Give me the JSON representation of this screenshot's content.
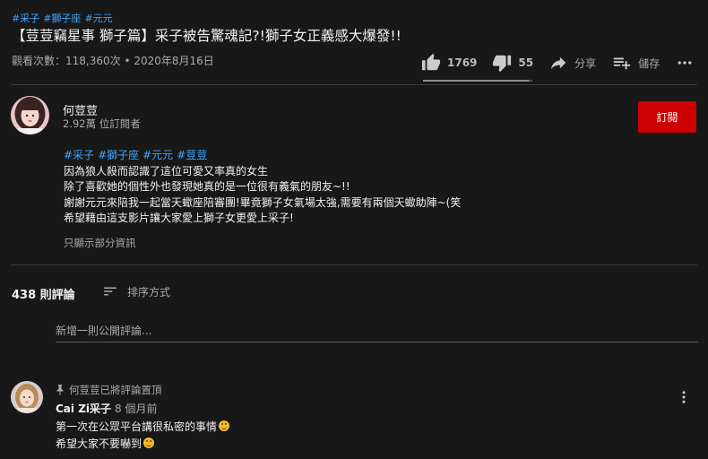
{
  "video": {
    "hashtags": [
      "#采子",
      "#獅子座",
      "#元元"
    ],
    "title": "【荳荳竊星事 獅子篇】采子被告驚魂記?!獅子女正義感大爆發!!",
    "views": "觀看次數：118,360次",
    "date": "2020年8月16日",
    "likes": "1769",
    "dislikes": "55",
    "share_label": "分享",
    "save_label": "儲存",
    "like_ratio": 0.97
  },
  "channel": {
    "name": "何荳荳",
    "subscribers": "2.92萬 位訂閱者",
    "subscribe_label": "訂閱"
  },
  "description": {
    "hashtags": [
      "#采子",
      "#獅子座",
      "#元元",
      "#荳荳"
    ],
    "lines": [
      "因為狼人殺而認識了這位可愛又率真的女生",
      "除了喜歡她的個性外也發現她真的是一位很有義氣的朋友~!!",
      "謝謝元元來陪我一起當天蠍座陪審團!畢竟獅子女氣場太強,需要有兩個天蠍助陣~(笑",
      "希望藉由這支影片讓大家愛上獅子女更愛上采子!"
    ],
    "show_less": "只顯示部分資訊"
  },
  "comments": {
    "count": "438 則評論",
    "sort_label": "排序方式",
    "add_placeholder": "新增一則公開評論...",
    "items": [
      {
        "pinned_by": "何荳荳已將評論置頂",
        "author": "Cai Zi采子",
        "time": "8 個月前",
        "line1": "第一次在公眾平台講很私密的事情",
        "line2": "希望大家不要嚇到"
      }
    ]
  },
  "colors": {
    "background": "#181818",
    "link": "#3ea6ff",
    "subscribe": "#cc0000",
    "muted": "#aaaaaa"
  }
}
